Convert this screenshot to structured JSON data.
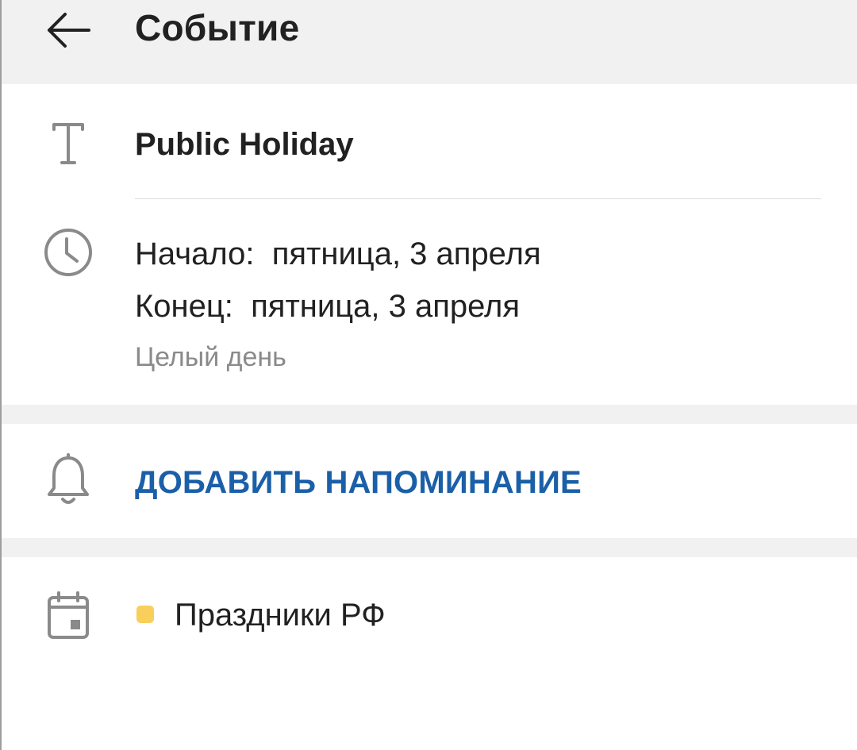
{
  "app_bar": {
    "title": "Событие",
    "back_icon": "arrow-left-icon"
  },
  "event": {
    "title_icon": "text-t-icon",
    "title": "Public Holiday"
  },
  "time": {
    "icon": "clock-icon",
    "start": "Начало:  пятница, 3 апреля",
    "end": "Конец:  пятница, 3 апреля",
    "all_day": "Целый день"
  },
  "reminder": {
    "icon": "bell-icon",
    "add_label": "ДОБАВИТЬ НАПОМИНАНИЕ"
  },
  "calendar": {
    "icon": "calendar-icon",
    "name": "Праздники РФ",
    "color": "#f7cf5a"
  },
  "colors": {
    "accent": "#1b5fa8",
    "icon_gray": "#7a7a7a",
    "section_gap": "#f1f1f1"
  }
}
